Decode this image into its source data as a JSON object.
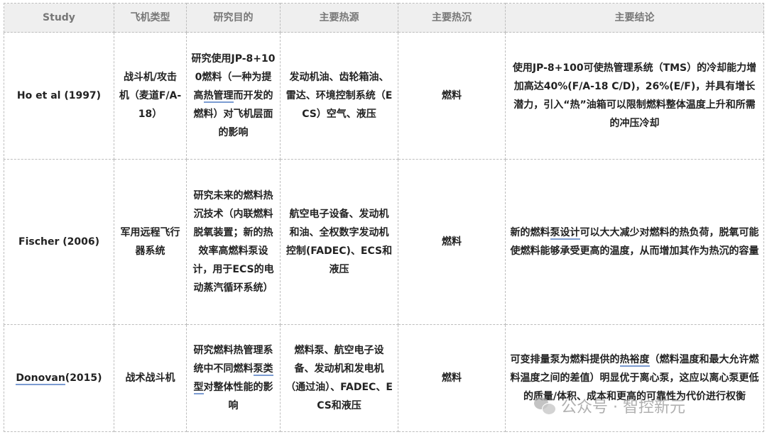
{
  "headers": [
    "Study",
    "飞机类型",
    "研究目的",
    "主要热源",
    "主要热沉",
    "主要结论"
  ],
  "rows": [
    {
      "study": "Ho et al (1997)",
      "aircraft": "战斗机/攻击机（麦道F/A-18）",
      "purpose_pre": "研究使用JP-8+100燃料（一种为提高",
      "purpose_ul": "热管理",
      "purpose_post": "而开发的燃料）对飞机层面的影响",
      "heat_source": "发动机油、齿轮箱油、雷达、环境控制系统（ECS）空气、液压",
      "heat_sink": "燃料",
      "conclusion_pre": "使用JP-8+100可使热管理系统（TMS）的冷却能力增加高达40%(F/A-18 C/D)，26%(E/F)，并具有增长潜力，引入“热”油箱可以限制燃料整体温度上升和所需的冲压冷却",
      "conclusion_ul": "",
      "conclusion_post": ""
    },
    {
      "study": "Fischer (2006)",
      "aircraft": "军用远程飞行器系统",
      "purpose_pre": "研究未来的燃料热沉技术（内联燃料脱氧装置；新的热效率高燃料泵设计，用于ECS的电动蒸汽循环系统）",
      "purpose_ul": "",
      "purpose_post": "",
      "heat_source": "航空电子设备、发动机和油、全权数字发动机控制(FADEC)、ECS和液压",
      "heat_sink": "燃料",
      "conclusion_pre": "新的燃料",
      "conclusion_ul": "泵设计",
      "conclusion_post": "可以大大减少对燃料的热负荷，脱氧可能使燃料能够承受更高的温度，从而增加其作为热沉的容量"
    },
    {
      "study_ul": "Donovan",
      "study_post": "(2015)",
      "aircraft": "战术战斗机",
      "purpose_pre": "研究燃料热管理系统中不同燃料",
      "purpose_ul": "泵类型",
      "purpose_post": "对整体性能的影响",
      "heat_source": "燃料泵、航空电子设备、发动机和发电机（通过油）、FADEC、ECS和液压",
      "heat_sink": "燃料",
      "conclusion_pre": "可变排量泵为燃料提供的",
      "conclusion_ul": "热裕度",
      "conclusion_post": "（燃料温度和最大允许燃料温度之间的差值）明显优于离心泵，这应以离心泵更低的质量/体积、成本和更高的可靠性为代价进行权衡"
    }
  ],
  "watermark": {
    "icon": "wechat-icon",
    "text": "公众号 · 智控新元"
  }
}
